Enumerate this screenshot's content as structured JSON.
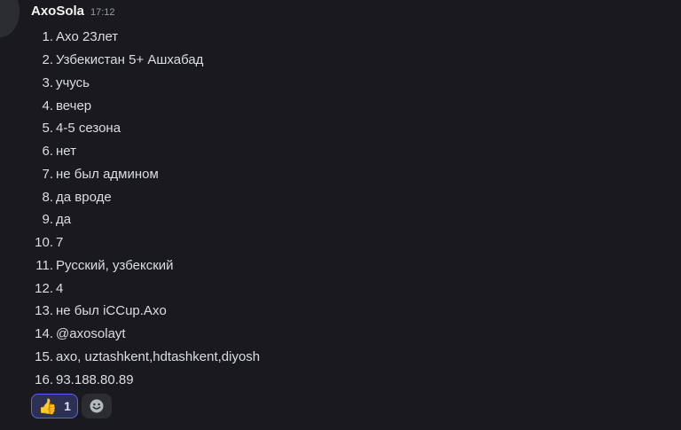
{
  "message": {
    "username": "AxoSola",
    "timestamp": "17:12",
    "answers": [
      {
        "num": "1.",
        "text": "Axo 23лет"
      },
      {
        "num": "2.",
        "text": "Узбекистан 5+ Ашхабад"
      },
      {
        "num": "3.",
        "text": "учусь"
      },
      {
        "num": "4.",
        "text": "вечер"
      },
      {
        "num": "5.",
        "text": "4-5 сезона"
      },
      {
        "num": "6.",
        "text": "нет"
      },
      {
        "num": "7.",
        "text": "не был админом"
      },
      {
        "num": "8.",
        "text": "да вроде"
      },
      {
        "num": "9.",
        "text": "да"
      },
      {
        "num": "10.",
        "text": "7"
      },
      {
        "num": "11.",
        "text": "Русский, узбекский"
      },
      {
        "num": "12.",
        "text": "4"
      },
      {
        "num": "13.",
        "text": "не был iCCup.Axo"
      },
      {
        "num": "14.",
        "text": "@axosolayt"
      },
      {
        "num": "15.",
        "text": "axo, uztashkent,hdtashkent,diyosh"
      },
      {
        "num": "16.",
        "text": "93.188.80.89"
      }
    ]
  },
  "reactions": [
    {
      "emoji": "👍",
      "icon": "thumbs-up-icon",
      "count": "1"
    }
  ],
  "add_reaction_icon": "smiley-icon",
  "colors": {
    "background": "#1a1a1e",
    "accent": "#5865f2"
  }
}
